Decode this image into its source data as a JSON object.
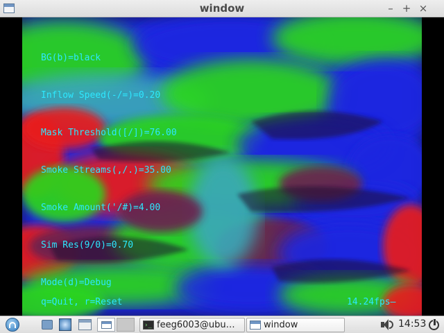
{
  "window": {
    "title": "window",
    "controls": {
      "minimize": "–",
      "maximize": "+",
      "close": "×"
    }
  },
  "hud": {
    "lines": [
      "BG(b)=black",
      "Inflow Speed(-/=)=0.20",
      "Mask Threshold([/])=76.00",
      "Smoke Streams(,/.)=35.00",
      "Smoke Amount('/#)=4.00",
      "Sim Res(9/0)=0.70",
      "Mode(d)=Debug"
    ],
    "text_color": "#2de8ff"
  },
  "footer": {
    "hint": "q=Quit, r=Reset",
    "fps": "14.24fps–"
  },
  "visualization": {
    "background": "#000000",
    "palette": [
      "#e81e1e",
      "#2bd61f",
      "#1f26e0",
      "#6b2050",
      "#3aa8b8"
    ]
  },
  "taskbar": {
    "launchers": [
      "start-menu-icon",
      "file-manager-icon",
      "browser-icon",
      "terminal-app-icon"
    ],
    "desktops": [
      "desktop-1",
      "desktop-2"
    ],
    "tasks": [
      {
        "label": "feeg6003@ubu…",
        "icon": "terminal-icon"
      },
      {
        "label": "window",
        "icon": "window-icon"
      }
    ],
    "clock": "14:53"
  }
}
